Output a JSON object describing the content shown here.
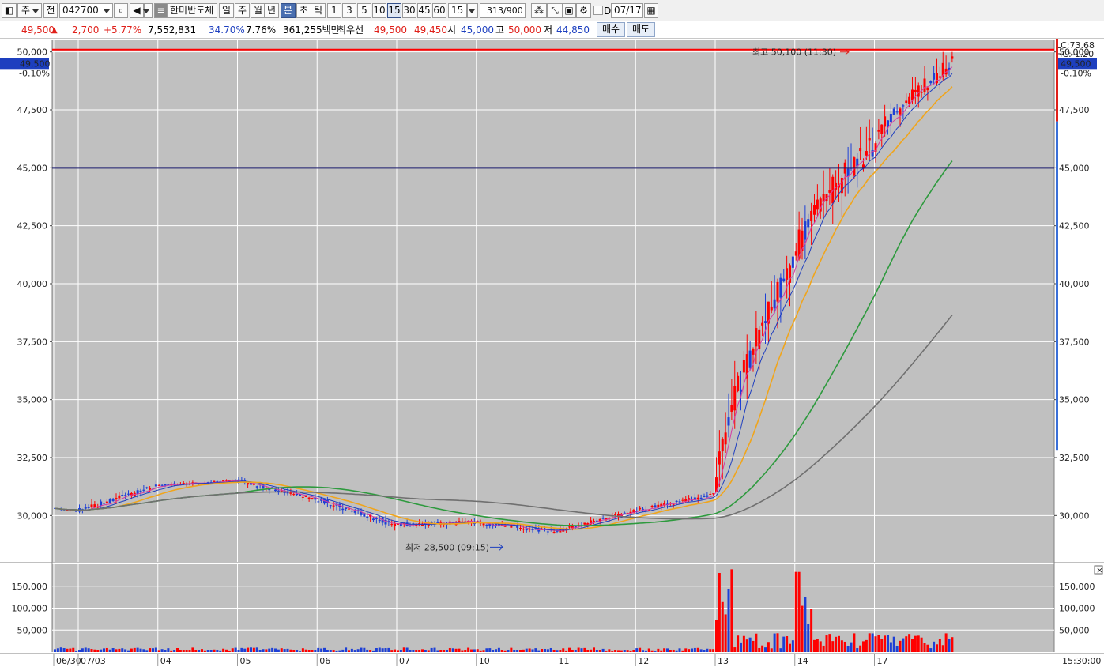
{
  "toolbar": {
    "market_type": "주",
    "full_label": "전",
    "code": "042700",
    "stock_name": "한미반도체",
    "period_labels": [
      "일",
      "주",
      "월",
      "년",
      "분",
      "초",
      "틱"
    ],
    "selected_period": "분",
    "interval_labels": [
      "1",
      "3",
      "5",
      "10",
      "15",
      "30",
      "45",
      "60"
    ],
    "selected_interval": "15",
    "interval_value": "15",
    "count_current": "313",
    "count_total": "/900",
    "date_value": "07/17",
    "date_checkbox_label": "D"
  },
  "quote": {
    "price": "49,500",
    "change_arrow": "▲",
    "change": "2,700",
    "change_pct": "+5.77%",
    "volume": "7,552,831",
    "volume_ratio": "34.70%",
    "turnover": "7.76%",
    "trade_amount": "361,255백만",
    "best_label": "최우선",
    "best_ask": "49,500",
    "best_bid": "49,450",
    "open_label": "시",
    "open": "45,000",
    "high_label": "고",
    "high": "50,000",
    "low_label": "저",
    "low": "44,850",
    "buy_button": "매수",
    "sell_button": "매도"
  },
  "chart_data": {
    "type": "candlestick",
    "y_ticks": [
      "50,000",
      "47,500",
      "45,000",
      "42,500",
      "40,000",
      "37,500",
      "35,000",
      "32,500",
      "30,000"
    ],
    "y_range": [
      28000,
      50500
    ],
    "x_labels": [
      "06/30",
      "07/03",
      "04",
      "05",
      "06",
      "07",
      "10",
      "11",
      "12",
      "13",
      "14",
      "17"
    ],
    "volume_ticks": [
      "150,000",
      "100,000",
      "50,000"
    ],
    "volume_range": [
      0,
      200000
    ],
    "price_tag_left": "49,500",
    "price_tag_left_pct": "-0.10%",
    "price_tag_right": "49,500",
    "price_tag_right_pct": "-0.10%",
    "lc_label": "LC:73.68",
    "hc_label": "HC:-1.20",
    "high_annotation": "최고 50,100 (11:30)",
    "low_annotation": "최저 28,500 (09:15)",
    "session_close_label": "15:30:00",
    "horizontal_levels": [
      {
        "value": 50100,
        "color": "#ff0000"
      },
      {
        "value": 45000,
        "color": "#1a1a6e"
      }
    ],
    "days": [
      {
        "label": "06/30",
        "bars": 8,
        "open": 30300,
        "close": 30200,
        "high": 30450,
        "low": 29900
      },
      {
        "label": "07/03",
        "bars": 26,
        "open": 30200,
        "close": 31300,
        "high": 32100,
        "low": 30100
      },
      {
        "label": "04",
        "bars": 26,
        "open": 31300,
        "close": 31500,
        "high": 31800,
        "low": 31000
      },
      {
        "label": "05",
        "bars": 26,
        "open": 31500,
        "close": 30700,
        "high": 31700,
        "low": 30300
      },
      {
        "label": "06",
        "bars": 26,
        "open": 30700,
        "close": 29600,
        "high": 30800,
        "low": 29000
      },
      {
        "label": "07",
        "bars": 26,
        "open": 29600,
        "close": 29700,
        "high": 30700,
        "low": 29200
      },
      {
        "label": "10",
        "bars": 26,
        "open": 29700,
        "close": 29300,
        "high": 29900,
        "low": 28500
      },
      {
        "label": "11",
        "bars": 26,
        "open": 29300,
        "close": 30200,
        "high": 30400,
        "low": 29100
      },
      {
        "label": "12",
        "bars": 26,
        "open": 30200,
        "close": 30900,
        "high": 31400,
        "low": 30000
      },
      {
        "label": "13",
        "bars": 26,
        "open": 31000,
        "close": 41100,
        "high": 41200,
        "low": 31000
      },
      {
        "label": "14",
        "bars": 26,
        "open": 41100,
        "close": 46000,
        "high": 50100,
        "low": 41000
      },
      {
        "label": "17",
        "bars": 26,
        "open": 46000,
        "close": 49500,
        "high": 50000,
        "low": 44850
      }
    ],
    "ma_colors": [
      "#d43aa4",
      "#1f3fbf",
      "#f0a51c",
      "#2e9a3e",
      "#707070"
    ],
    "colors": {
      "up": "#ff0000",
      "down": "#1d3fd6",
      "grid": "#ffffff",
      "plot_bg": "#c0c0c0"
    }
  }
}
